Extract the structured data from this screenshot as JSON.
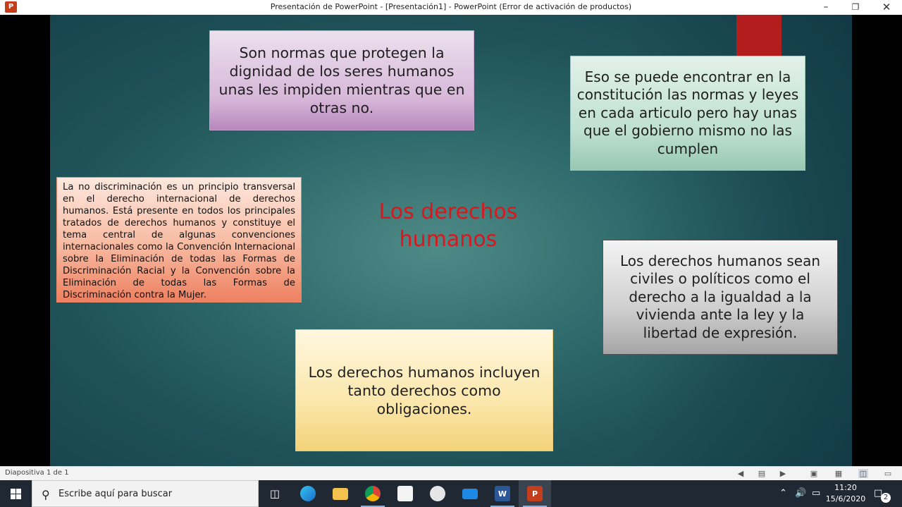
{
  "window": {
    "title": "Presentación de PowerPoint - [Presentación1] - PowerPoint (Error de activación de productos)",
    "app_icon_letter": "P",
    "minimize": "–",
    "restore": "❐",
    "close": "✕"
  },
  "slide": {
    "title": "Los derechos humanos",
    "boxes": {
      "pink": "Son normas que protegen la dignidad de los seres humanos unas les impiden mientras que en otras no.",
      "green": "Eso se puede encontrar en la constitución las normas y leyes en cada articulo pero hay unas que el gobierno mismo no las cumplen",
      "orange": "La no discriminación es un principio transversal en el derecho internacional de derechos humanos. Está presente en todos los principales tratados de derechos humanos y constituye el tema central de algunas convenciones internacionales como la Convención Internacional sobre la Eliminación de todas las Formas de Discriminación Racial y la Convención sobre la Eliminación de todas las Formas de Discriminación contra la Mujer.",
      "gray": "Los derechos humanos sean civiles o políticos como el derecho a la igualdad a la vivienda ante la ley y la libertad de expresión.",
      "yellow": "Los derechos humanos incluyen tanto derechos como obligaciones."
    },
    "colors": {
      "title": "#d9171c",
      "red_tab": "#b31d1d"
    }
  },
  "statusbar": {
    "slide_count": "Diapositiva 1 de 1"
  },
  "taskbar": {
    "search_placeholder": "Escribe aquí para buscar",
    "apps": [
      "task-view",
      "edge",
      "file-explorer",
      "chrome",
      "store",
      "paint",
      "mail",
      "word",
      "powerpoint"
    ],
    "word_letter": "W",
    "ppt_letter": "P",
    "time": "11:20",
    "date": "15/6/2020",
    "notifications": "2"
  }
}
